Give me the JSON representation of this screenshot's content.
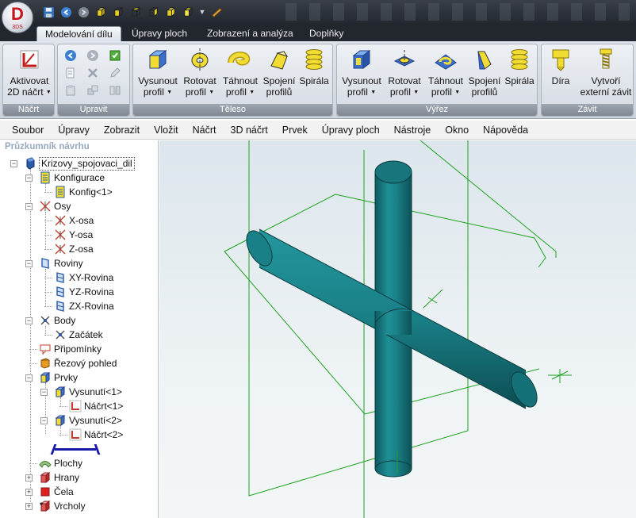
{
  "app": {
    "logo_letter": "D",
    "logo_sub": "3DS"
  },
  "quick_access": {
    "icons": [
      "save-icon",
      "undo-icon",
      "redo-icon",
      "view-cube-icon",
      "view-cube-front-icon",
      "view-cube-top-icon",
      "view-cube-side-icon",
      "view-cube-iso-icon",
      "view-cube-back-icon",
      "measure-icon"
    ]
  },
  "ribbon_tabs": [
    {
      "label": "Modelování dílu",
      "active": true
    },
    {
      "label": "Úpravy ploch",
      "active": false
    },
    {
      "label": "Zobrazení a analýza",
      "active": false
    },
    {
      "label": "Doplňky",
      "active": false
    }
  ],
  "ribbon": {
    "groups": {
      "nacrt": "Náčrt",
      "upravit": "Upravit",
      "teleso": "Těleso",
      "vyrez": "Výřez",
      "zavit": "Závit"
    },
    "nacrt": {
      "activate_l1": "Aktivovat",
      "activate_l2": "2D náčrt"
    },
    "teleso": {
      "extrude_l1": "Vysunout",
      "extrude_l2": "profil",
      "revolve_l1": "Rotovat",
      "revolve_l2": "profil",
      "sweep_l1": "Táhnout",
      "sweep_l2": "profil",
      "loft_l1": "Spojení",
      "loft_l2": "profilů",
      "spiral": "Spirála"
    },
    "vyrez": {
      "extrude_l1": "Vysunout",
      "extrude_l2": "profil",
      "revolve_l1": "Rotovat",
      "revolve_l2": "profil",
      "sweep_l1": "Táhnout",
      "sweep_l2": "profil",
      "loft_l1": "Spojení",
      "loft_l2": "profilů",
      "spiral": "Spirála"
    },
    "zavit": {
      "hole": "Díra",
      "thread_l1": "Vytvoří",
      "thread_l2": "externí závit"
    }
  },
  "menu": [
    "Soubor",
    "Úpravy",
    "Zobrazit",
    "Vložit",
    "Náčrt",
    "3D náčrt",
    "Prvek",
    "Úpravy ploch",
    "Nástroje",
    "Okno",
    "Nápověda"
  ],
  "explorer": {
    "title": "Průzkumník návrhu",
    "nodes": [
      {
        "label": "Krizovy_spojovaci_dil",
        "icon": "part-icon"
      },
      {
        "label": "Konfigurace",
        "icon": "configuration-icon"
      },
      {
        "label": "Konfig<1>",
        "icon": "configuration-icon"
      },
      {
        "label": "Osy",
        "icon": "axes-icon"
      },
      {
        "label": "X-osa",
        "icon": "axis-icon"
      },
      {
        "label": "Y-osa",
        "icon": "axis-icon"
      },
      {
        "label": "Z-osa",
        "icon": "axis-icon"
      },
      {
        "label": "Roviny",
        "icon": "planes-icon"
      },
      {
        "label": "XY-Rovina",
        "icon": "plane-icon"
      },
      {
        "label": "YZ-Rovina",
        "icon": "plane-icon"
      },
      {
        "label": "ZX-Rovina",
        "icon": "plane-icon"
      },
      {
        "label": "Body",
        "icon": "points-icon"
      },
      {
        "label": "Začátek",
        "icon": "origin-icon"
      },
      {
        "label": "Připomínky",
        "icon": "annotations-icon"
      },
      {
        "label": "Řezový pohled",
        "icon": "section-view-icon"
      },
      {
        "label": "Prvky",
        "icon": "features-icon"
      },
      {
        "label": "Vysunutí<1>",
        "icon": "extrude-feature-icon"
      },
      {
        "label": "Náčrt<1>",
        "icon": "sketch-icon"
      },
      {
        "label": "Vysunutí<2>",
        "icon": "extrude-feature-icon"
      },
      {
        "label": "Náčrt<2>",
        "icon": "sketch-icon"
      },
      {
        "label": "",
        "icon": "rollback-bar-icon"
      },
      {
        "label": "Plochy",
        "icon": "surfaces-icon"
      },
      {
        "label": "Hrany",
        "icon": "edges-icon"
      },
      {
        "label": "Čela",
        "icon": "faces-icon"
      },
      {
        "label": "Vrcholy",
        "icon": "vertices-icon"
      }
    ]
  },
  "colors": {
    "solid": "#1a7f86",
    "solid_dark": "#0d5a60",
    "plane_outline": "#1fa31f",
    "viewport_bg": "#e6eef2"
  }
}
